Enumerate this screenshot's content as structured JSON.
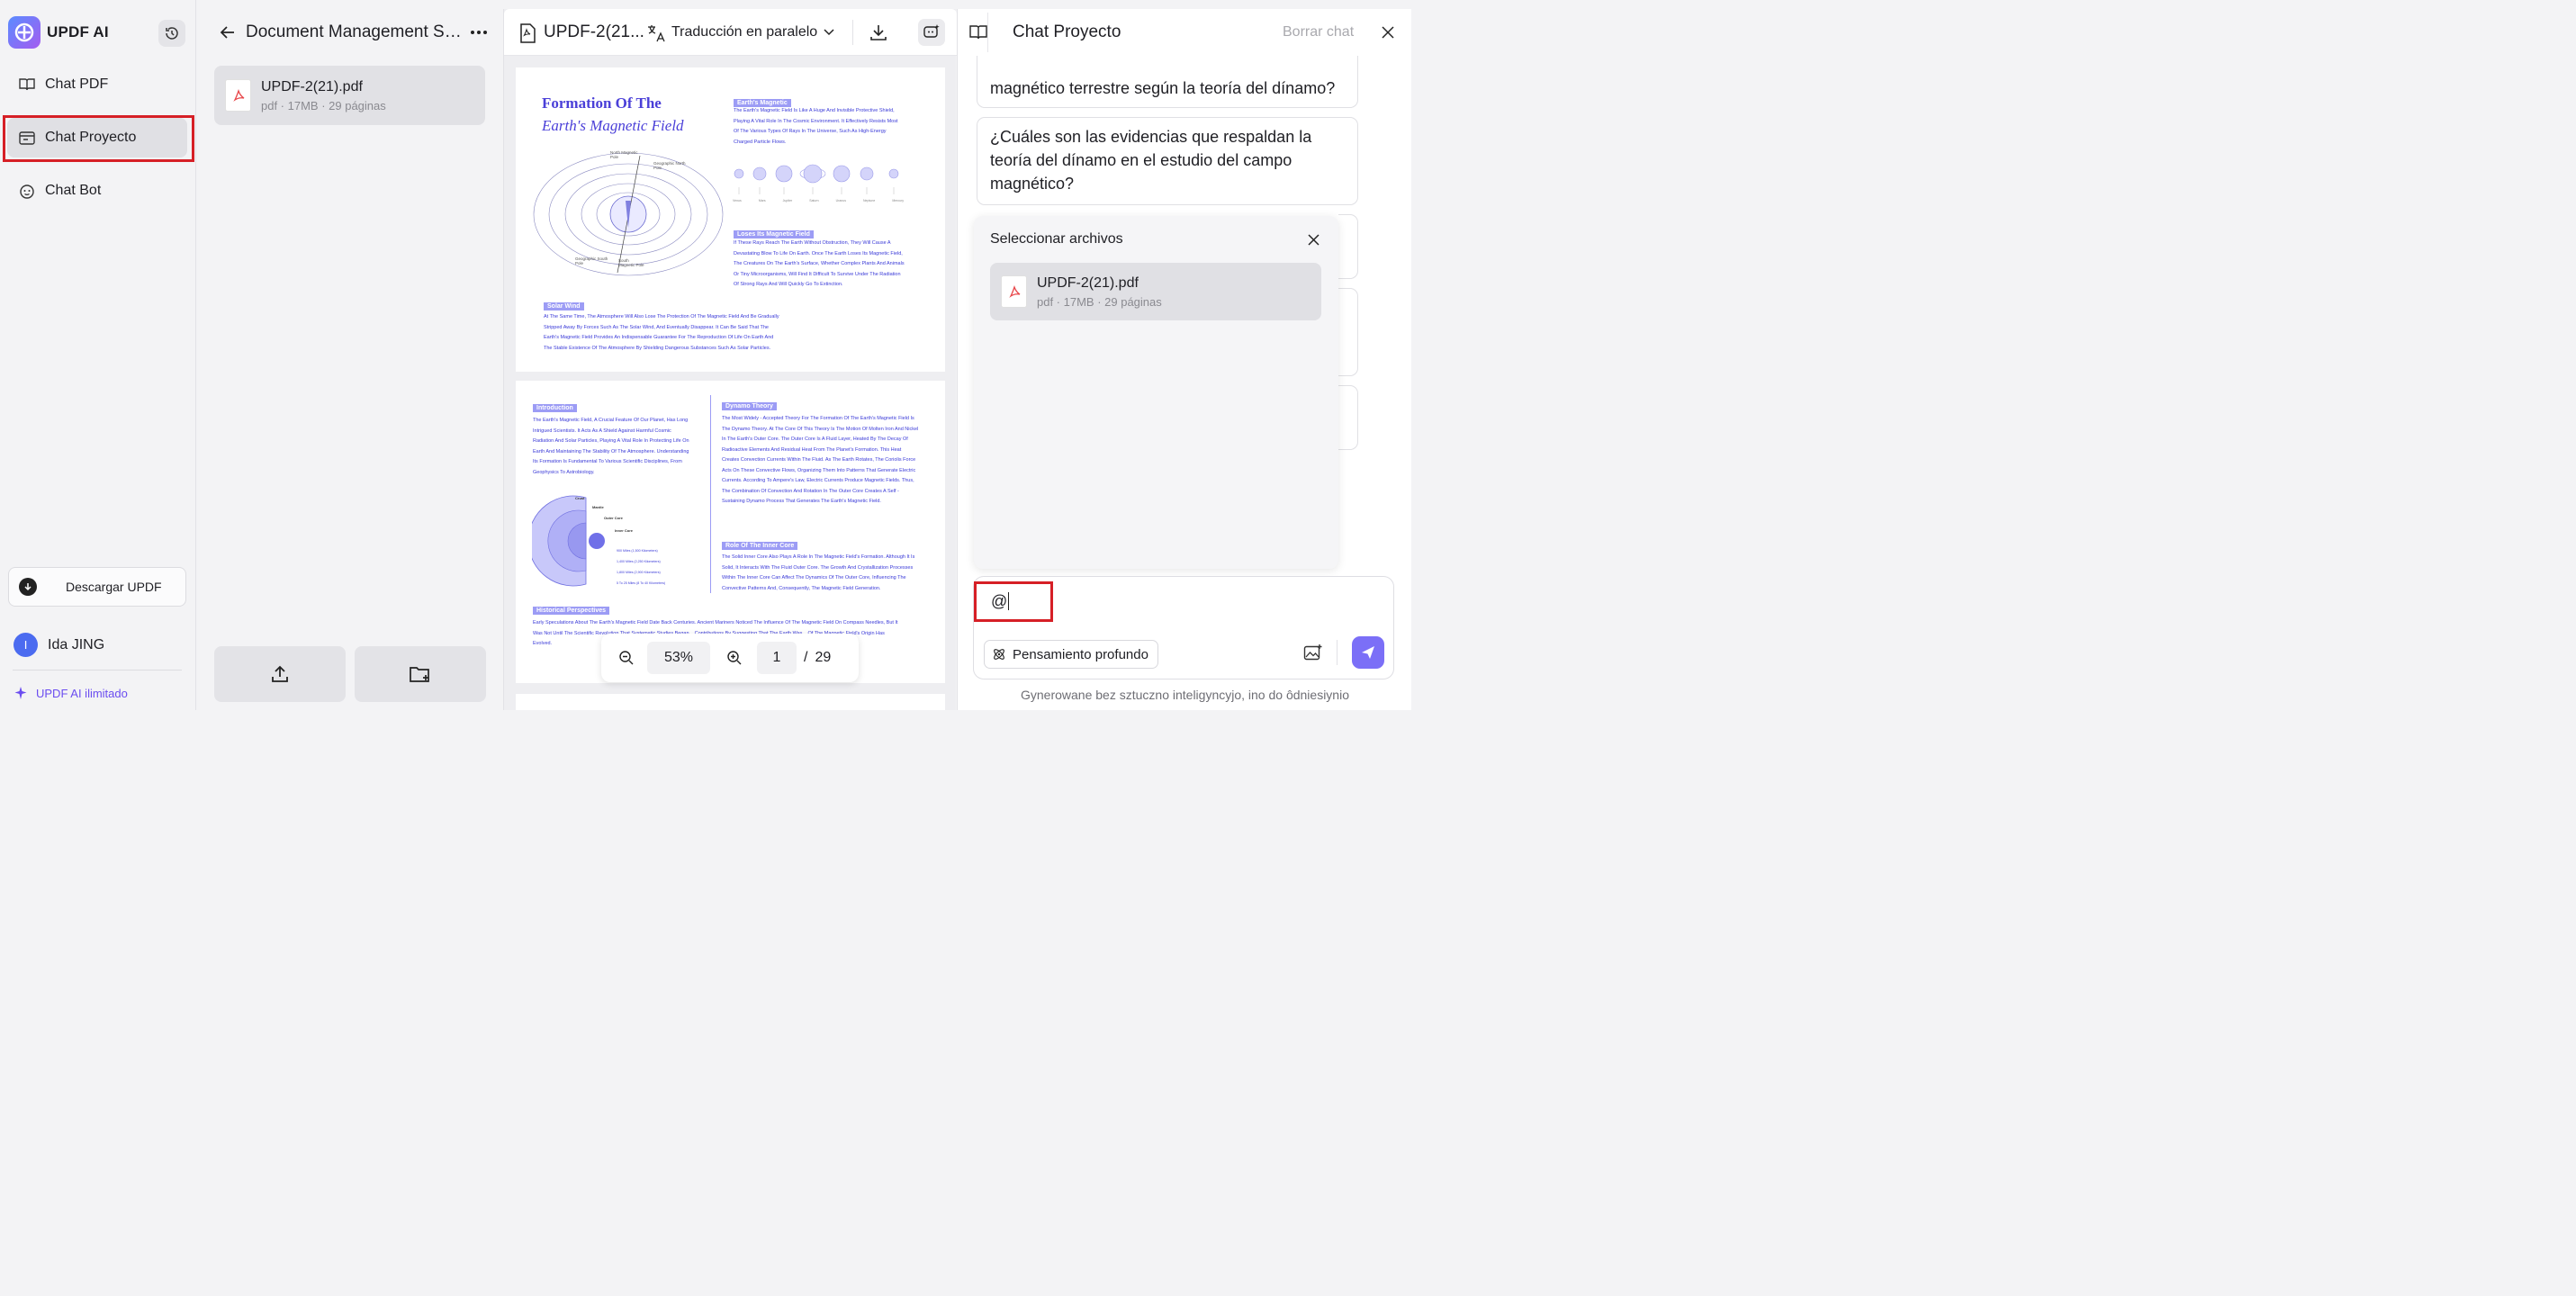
{
  "sidebar": {
    "app_name": "UPDF AI",
    "items": [
      {
        "label": "Chat PDF"
      },
      {
        "label": "Chat Proyecto"
      },
      {
        "label": "Chat Bot"
      }
    ],
    "download_label": "Descargar UPDF",
    "user_initial": "I",
    "user_name": "Ida JING",
    "unlimited_label": "UPDF AI ilimitado"
  },
  "project": {
    "title": "Document Management Sy...",
    "file": {
      "name": "UPDF-2(21).pdf",
      "meta": "pdf · 17MB · 29 páginas"
    }
  },
  "viewer": {
    "file_title": "UPDF-2(21...",
    "translate_label": "Traducción en paralelo",
    "zoom": "53%",
    "page_current": "1",
    "page_separator": "/",
    "page_total": "29",
    "page1": {
      "title_line1": "Formation Of The",
      "title_line2": "Earth's Magnetic Field",
      "tag_magnetic": "Earth's Magnetic",
      "text_magnetic": "The Earth's Magnetic Field Is Like A Huge And Invisible Protective Shield, Playing A Vital Role In The Cosmic Environment. It Effectively Resists Most Of The Various Types Of Rays In The Universe, Such As High-Energy Charged Particle Flows.",
      "tag_loses": "Loses Its Magnetic Field",
      "text_loses": "If These Rays Reach The Earth Without Obstruction, They Will Cause A Devastating Blow To Life On Earth. Once The Earth Loses Its Magnetic Field, The Creatures On The Earth's Surface, Whether Complex Plants And Animals Or Tiny Microorganisms, Will Find It Difficult To Survive Under The Radiation Of Strong Rays And Will Quickly Go To Extinction.",
      "tag_solar": "Solar Wind",
      "text_solar": "At The Same Time, The Atmosphere Will Also Lose The Protection Of The Magnetic Field And Be Gradually Stripped Away By Forces Such As The Solar Wind, And Eventually Disappear. It Can Be Said That The Earth's Magnetic Field Provides An Indispensable Guarantee For The Reproduction Of Life On Earth And The Stable Existence Of The Atmosphere By Shielding Dangerous Substances Such As Solar Particles.",
      "planets": [
        "Venus",
        "Mars",
        "Jupiter",
        "Saturn",
        "Uranus",
        "Neptune",
        "Mercury"
      ],
      "pole_labels": [
        "North Magnetic Pole",
        "Geographic North Pole",
        "Geographic South Pole",
        "South Magnetic Pole"
      ]
    },
    "page2": {
      "tag_intro": "Introduction",
      "text_intro": "The Earth's Magnetic Field, A Crucial Feature Of Our Planet, Has Long Intrigued Scientists. It Acts As A Shield Against Harmful Cosmic Radiation And Solar Particles, Playing A Vital Role In Protecting Life On Earth And Maintaining The Stability Of The Atmosphere. Understanding Its Formation Is Fundamental To Various Scientific Disciplines, From Geophysics To Astrobiology.",
      "tag_dynamo": "Dynamo Theory",
      "text_dynamo": "The Most Widely - Accepted Theory For The Formation Of The Earth's Magnetic Field Is The Dynamo Theory. At The Core Of This Theory Is The Motion Of Molten Iron And Nickel In The Earth's Outer Core. The Outer Core Is A Fluid Layer, Heated By The Decay Of Radioactive Elements And Residual Heat From The Planet's Formation. This Heat Creates Convection Currents Within The Fluid. As The Earth Rotates, The Coriolis Force Acts On These Convective Flows, Organizing Them Into Patterns That Generate Electric Currents. According To Ampere's Law, Electric Currents Produce Magnetic Fields. Thus, The Combination Of Convection And Rotation In The Outer Core Creates A Self - Sustaining Dynamo Process That Generates The Earth's Magnetic Field.",
      "tag_inner": "Role Of The Inner Core",
      "text_inner": "The Solid Inner Core Also Plays A Role In The Magnetic Field's Formation. Although It Is Solid, It Interacts With The Fluid Outer Core. The Growth And Crystallization Processes Within The Inner Core Can Affect The Dynamics Of The Outer Core, Influencing The Convective Patterns And, Consequently, The Magnetic Field Generation.",
      "tag_hist": "Historical Perspectives",
      "text_hist": "Early Speculations About The Earth's Magnetic Field Date Back Centuries. Ancient Mariners Noticed The Influence Of The Magnetic Field On Compass Needles, But It Was Not Until The Scientific Revolution That Systematic Studies Began... Contributions By Suggesting That The Earth Was... Of The Magnetic Field's Origin Has Evolved.",
      "layers": [
        "Crust",
        "Mantle",
        "Outer Core",
        "Inner Core"
      ],
      "layer_depths": [
        "900 Miles (1,500 Kilometers)",
        "1,400 Miles (2,250 Kilometers)",
        "1,800 Miles (2,900 Kilometers)",
        "5 To 25 Miles (8 To 40 Kilometers)"
      ]
    }
  },
  "chat": {
    "title": "Chat Proyecto",
    "clear_label": "Borrar chat",
    "messages": [
      "magnético terrestre según la teoría del dínamo?",
      "¿Cuáles son las evidencias que respaldan la teoría del dínamo en el estudio del campo magnético?"
    ],
    "picker": {
      "title": "Seleccionar archivos",
      "file_name": "UPDF-2(21).pdf",
      "file_meta": "pdf · 17MB · 29 páginas"
    },
    "input_value": "@",
    "deep_thinking_label": "Pensamiento profundo",
    "footnote": "Gynerowane bez sztuczno inteligyncyjo, ino do ôdniesiynio"
  },
  "colors": {
    "accent": "#7b6ff7",
    "highlight_box": "#d61f26",
    "pdf_blue": "#3a3ad8"
  }
}
